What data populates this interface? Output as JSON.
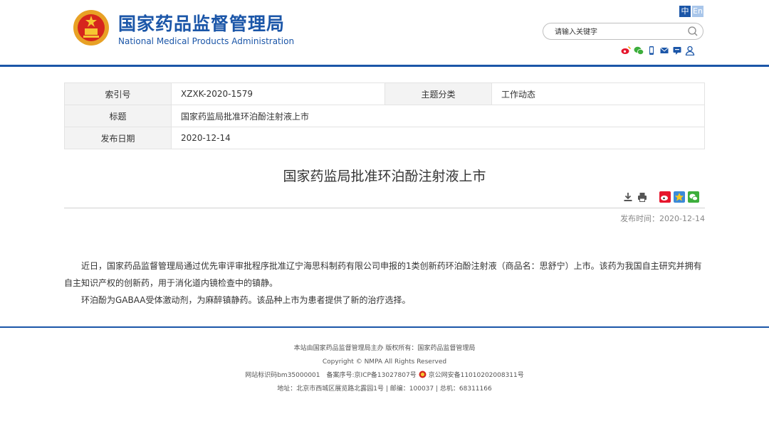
{
  "header": {
    "title_cn": "国家药品监督管理局",
    "title_en": "National Medical Products Administration",
    "lang_zh": "中",
    "lang_en": "En",
    "search_placeholder": "请输入关键字",
    "brand_color": "#1b56a8"
  },
  "info": {
    "index_label": "索引号",
    "index_value": "XZXK-2020-1579",
    "category_label": "主题分类",
    "category_value": "工作动态",
    "title_label": "标题",
    "title_value": "国家药监局批准环泊酚注射液上市",
    "date_label": "发布日期",
    "date_value": "2020-12-14"
  },
  "article": {
    "title": "国家药监局批准环泊酚注射液上市",
    "publish_time": "发布时间：2020-12-14",
    "paragraphs": [
      "近日，国家药品监督管理局通过优先审评审批程序批准辽宁海思科制药有限公司申报的1类创新药环泊酚注射液（商品名：思舒宁）上市。该药为我国自主研究并拥有自主知识产权的创新药，用于消化道内镜检查中的镇静。",
      "环泊酚为GABAA受体激动剂，为麻醉镇静药。该品种上市为患者提供了新的治疗选择。"
    ]
  },
  "footer": {
    "line1": "本站由国家药品监督管理局主办 版权所有：国家药品监督管理局",
    "line2": "Copyright © NMPA All Rights Reserved",
    "line3a": "网站标识码bm35000001　备案序号:京ICP备13027807号",
    "line3b": "京公网安备11010202008311号",
    "line4": "地址：北京市西城区展览路北露园1号 | 邮编：100037 | 总机：68311166"
  }
}
